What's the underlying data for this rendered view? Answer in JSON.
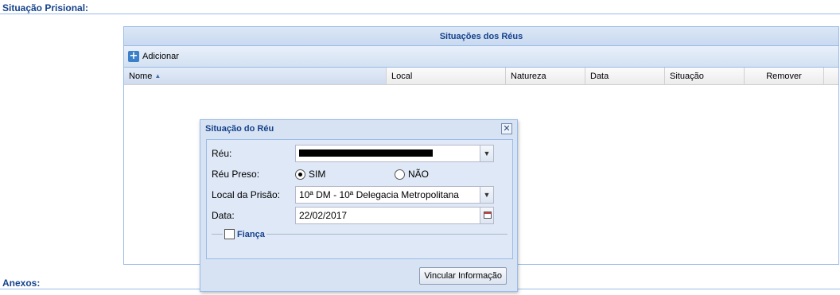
{
  "sections": {
    "situacao_prisional": "Situação Prisional:",
    "anexos": "Anexos:"
  },
  "grid": {
    "title": "Situações dos Réus",
    "add_label": "Adicionar",
    "columns": [
      "Nome",
      "Local",
      "Natureza",
      "Data",
      "Situação",
      "Remover"
    ]
  },
  "dialog": {
    "title": "Situação do Réu",
    "reu_label": "Réu:",
    "reu_preso_label": "Réu Preso:",
    "sim_label": "SIM",
    "nao_label": "NÃO",
    "reu_preso_selected": "SIM",
    "local_label": "Local da Prisão:",
    "local_value": "10ª DM - 10ª Delegacia Metropolitana",
    "data_label": "Data:",
    "data_value": "22/02/2017",
    "fianca_label": "Fiança",
    "fianca_checked": false,
    "submit_label": "Vincular Informação"
  }
}
